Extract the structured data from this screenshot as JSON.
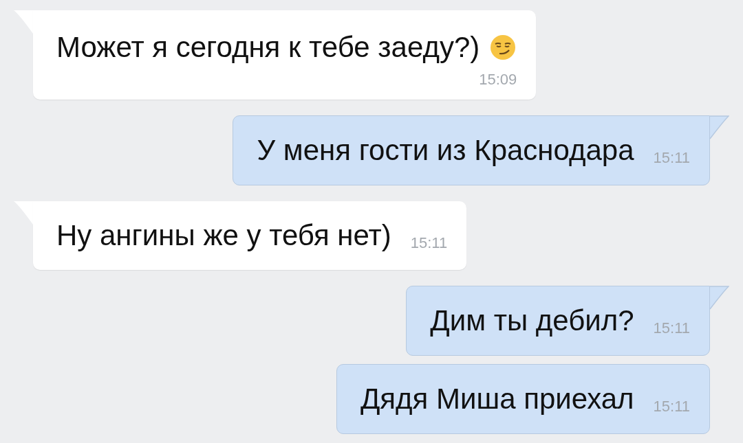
{
  "messages": [
    {
      "kind": "received",
      "tail": true,
      "text": "Может я сегодня к тебе заеду?)",
      "has_emoji": true,
      "time": "15:09",
      "time_below": true
    },
    {
      "kind": "sent",
      "tail": true,
      "text": "У меня гости из Краснодара",
      "time": "15:11",
      "time_below": false
    },
    {
      "kind": "received",
      "tail": true,
      "text": "Ну ангины же у тебя нет)",
      "time": "15:11",
      "time_below": false
    },
    {
      "kind": "sent",
      "tail": true,
      "text": "Дим ты дебил?",
      "time": "15:11",
      "time_below": false
    },
    {
      "kind": "sent",
      "tail": false,
      "text": "Дядя Миша приехал",
      "time": "15:11",
      "time_below": false
    }
  ]
}
